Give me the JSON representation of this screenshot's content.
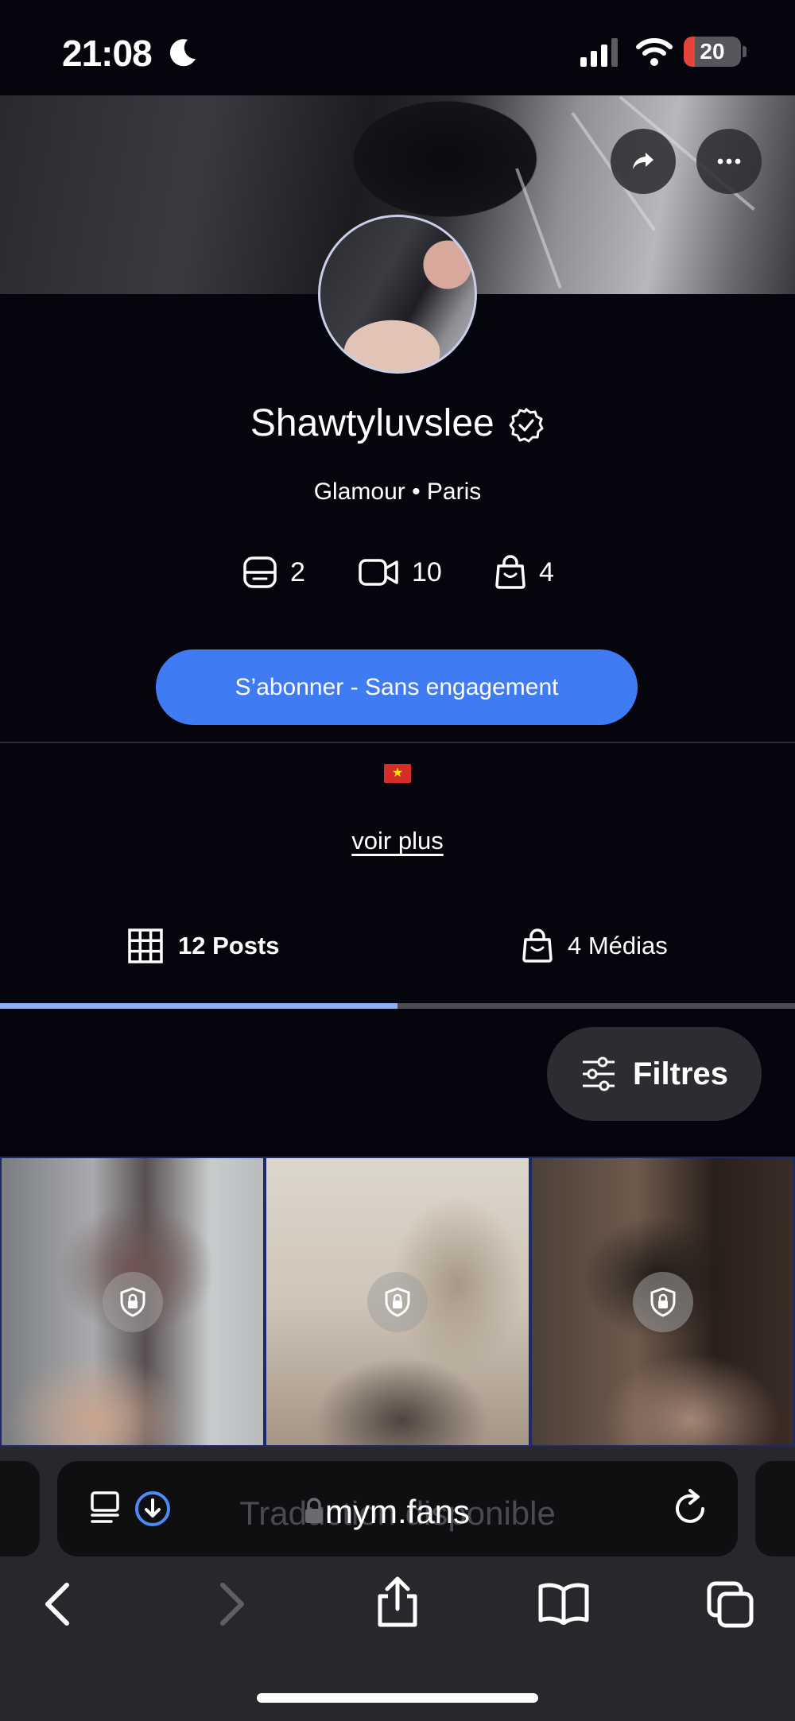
{
  "status_bar": {
    "time": "21:08",
    "battery_percent": "20",
    "icons": [
      "moon-icon",
      "cellular-signal-icon",
      "wifi-icon",
      "battery-icon"
    ]
  },
  "cover": {
    "actions": [
      "share-icon",
      "more-icon"
    ]
  },
  "profile": {
    "username": "Shawtyluvslee",
    "verified_icon": "verified-badge-icon",
    "subtitle": "Glamour • Paris",
    "stats": [
      {
        "icon": "photo-icon",
        "value": "2"
      },
      {
        "icon": "video-icon",
        "value": "10"
      },
      {
        "icon": "bag-icon",
        "value": "4"
      }
    ],
    "subscribe_label": "S’abonner - Sans engagement",
    "flag_icon": "vietnam-flag-icon",
    "see_more_label": "voir plus"
  },
  "tabs": [
    {
      "label": "12 Posts",
      "icon": "grid-icon",
      "active": true
    },
    {
      "label": "4 Médias",
      "icon": "bag-icon",
      "active": false
    }
  ],
  "filters_label": "Filtres",
  "posts": [
    {
      "locked": true
    },
    {
      "locked": true
    },
    {
      "locked": true
    }
  ],
  "browser": {
    "url": "mym.fans",
    "translation_hint": "Traduction disponible",
    "nav": [
      "back-icon",
      "forward-icon",
      "share-icon",
      "bookmarks-icon",
      "tabs-icon"
    ]
  },
  "colors": {
    "background": "#05050d",
    "accent": "#3f7cf4",
    "tab_active": "#8fb1f4"
  }
}
